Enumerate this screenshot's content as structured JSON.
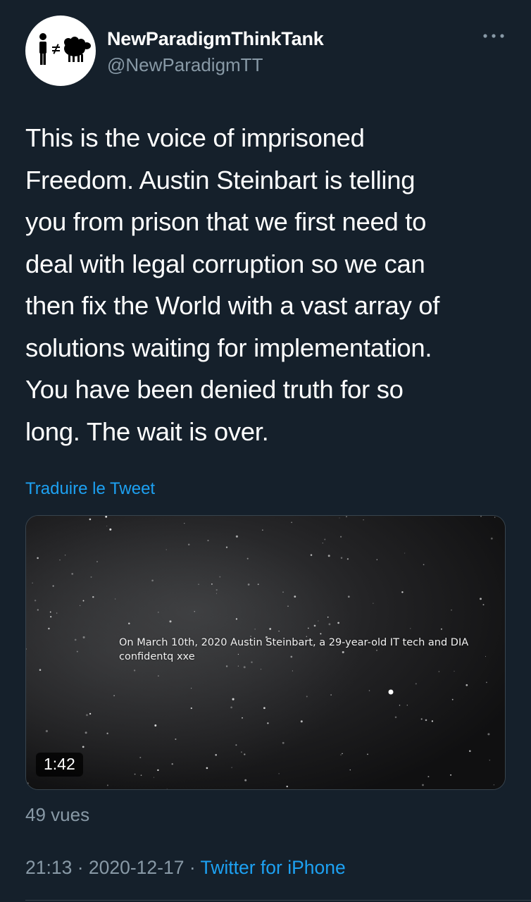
{
  "user": {
    "display_name": "NewParadigmThinkTank",
    "handle": "@NewParadigmTT"
  },
  "tweet": {
    "text": "This is the voice of imprisoned\nFreedom. Austin Steinbart is telling\nyou from prison that we first need to\ndeal with legal corruption so we can\nthen fix the World with a vast array of\nsolutions waiting for implementation.\nYou have been denied truth for so\nlong. The wait is over.",
    "translate_label": "Traduire le Tweet"
  },
  "media": {
    "caption": "On March 10th, 2020 Austin Steinbart, a 29-year-old IT tech and DIA\nconfidentq xxe",
    "duration": "1:42"
  },
  "stats": {
    "views": "49 vues"
  },
  "meta": {
    "time": "21:13",
    "date": "2020-12-17",
    "separator": " · ",
    "source": "Twitter for iPhone"
  },
  "colors": {
    "background": "#15202b",
    "text_primary": "#ffffff",
    "text_secondary": "#8899a6",
    "accent": "#1da1f2",
    "border": "#38444d"
  },
  "icons": {
    "more": "more-horizontal-icon",
    "avatar": "person-not-equal-sheep-logo"
  }
}
